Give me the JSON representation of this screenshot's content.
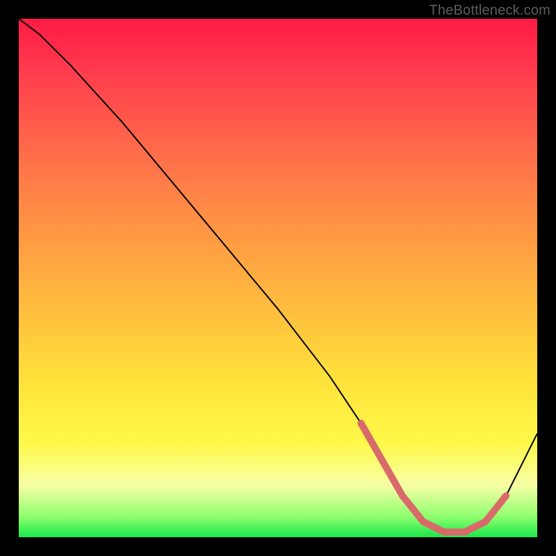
{
  "watermark": "TheBottleneck.com",
  "chart_data": {
    "type": "line",
    "title": "",
    "xlabel": "",
    "ylabel": "",
    "xlim": [
      0,
      100
    ],
    "ylim": [
      0,
      100
    ],
    "series": [
      {
        "name": "bottleneck-curve",
        "x": [
          0,
          4,
          10,
          20,
          30,
          40,
          50,
          60,
          66,
          70,
          74,
          78,
          82,
          86,
          90,
          94,
          100
        ],
        "y": [
          100,
          97,
          91,
          80,
          68,
          56,
          44,
          31,
          22,
          15,
          8,
          3,
          1,
          1,
          3,
          8,
          20
        ]
      }
    ],
    "highlight_segment": {
      "name": "optimal-range",
      "x": [
        66,
        70,
        74,
        78,
        82,
        86,
        90,
        94
      ],
      "y": [
        22,
        15,
        8,
        3,
        1,
        1,
        3,
        8
      ]
    },
    "curve_color": "#000000",
    "highlight_color": "#d96a6a",
    "background_gradient": [
      "#ff1a44",
      "#ff6a4a",
      "#ffbb3e",
      "#fff94a",
      "#19e84a"
    ]
  }
}
